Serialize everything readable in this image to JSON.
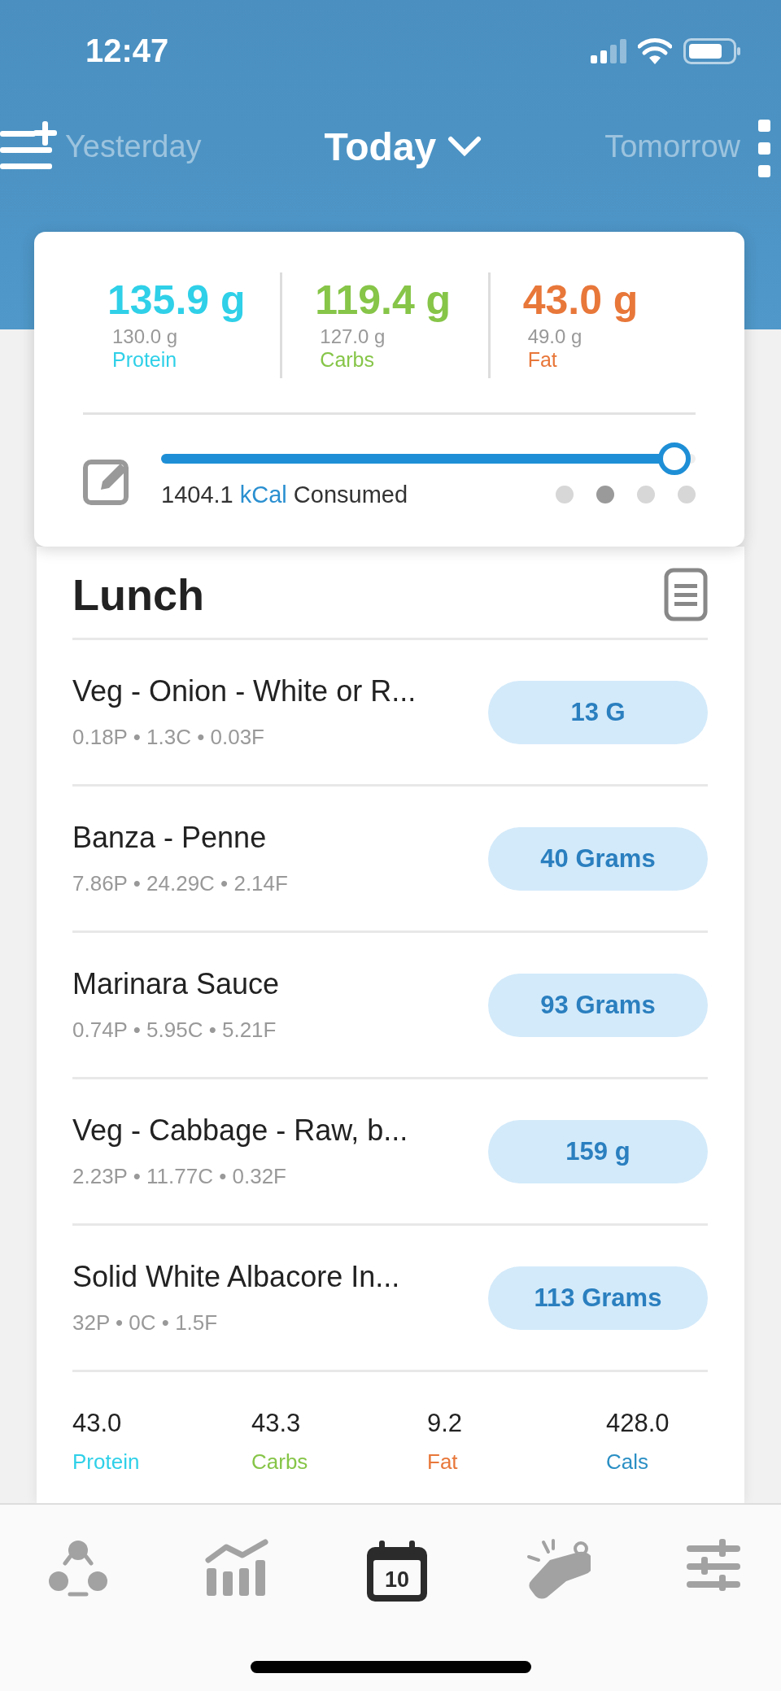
{
  "status_bar": {
    "time": "12:47"
  },
  "date_nav": {
    "previous": "Yesterday",
    "current": "Today",
    "next": "Tomorrow"
  },
  "summary": {
    "macros": [
      {
        "value": "135.9 g",
        "goal": "130.0 g",
        "label": "Protein",
        "color": "#2fd0e8"
      },
      {
        "value": "119.4 g",
        "goal": "127.0 g",
        "label": "Carbs",
        "color": "#86c548"
      },
      {
        "value": "43.0 g",
        "goal": "49.0 g",
        "label": "Fat",
        "color": "#e8773a"
      }
    ],
    "calories": {
      "amount": "1404.1",
      "unit": "kCal",
      "suffix": "Consumed",
      "level": 0.96
    },
    "pages": [
      {
        "selected": false
      },
      {
        "selected": true
      },
      {
        "selected": false
      },
      {
        "selected": false
      }
    ]
  },
  "meal": {
    "title": "Lunch",
    "foods": [
      {
        "name": "Veg - Onion - White or R...",
        "macros": "0.18P • 1.3C • 0.03F",
        "amount": "13 G"
      },
      {
        "name": "Banza - Penne",
        "macros": "7.86P • 24.29C • 2.14F",
        "amount": "40 Grams"
      },
      {
        "name": "Marinara Sauce",
        "macros": "0.74P • 5.95C • 5.21F",
        "amount": "93 Grams"
      },
      {
        "name": "Veg - Cabbage - Raw, b...",
        "macros": "2.23P • 11.77C • 0.32F",
        "amount": "159 g"
      },
      {
        "name": "Solid White Albacore In...",
        "macros": "32P • 0C • 1.5F",
        "amount": "113 Grams"
      }
    ],
    "totals": [
      {
        "value": "43.0",
        "label": "Protein",
        "color": "#2fd0e8"
      },
      {
        "value": "43.3",
        "label": "Carbs",
        "color": "#86c548"
      },
      {
        "value": "9.2",
        "label": "Fat",
        "color": "#e8773a"
      },
      {
        "value": "428.0",
        "label": "Cals",
        "color": "#2a8fc4"
      }
    ]
  },
  "tab_bar": [
    {
      "kind": "community",
      "selected": false
    },
    {
      "kind": "progress",
      "selected": false
    },
    {
      "kind": "diary",
      "selected": true,
      "badge": "10"
    },
    {
      "kind": "coach",
      "selected": false
    },
    {
      "kind": "settings",
      "selected": false
    }
  ]
}
